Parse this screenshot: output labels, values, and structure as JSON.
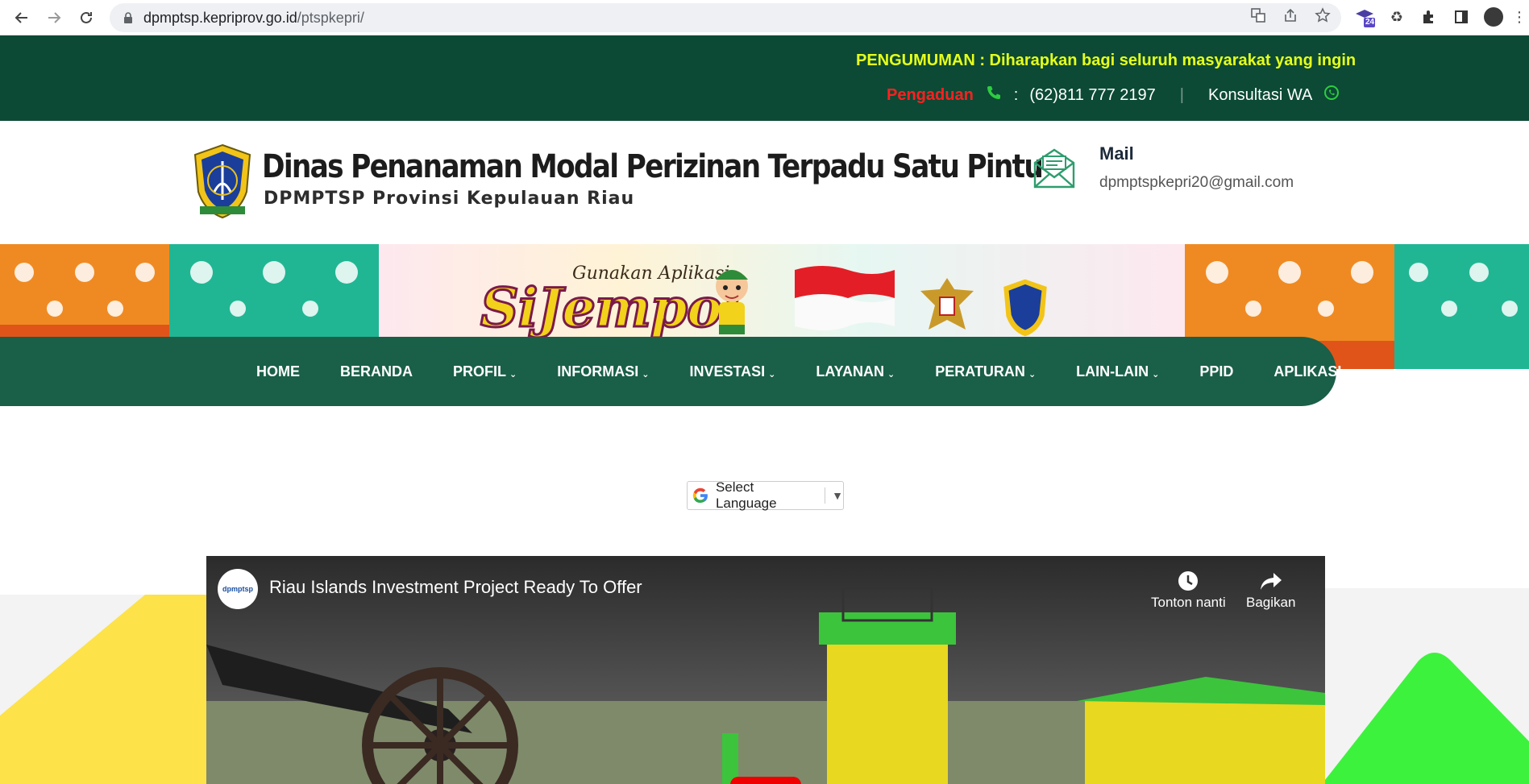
{
  "browser": {
    "url_host": "dpmptsp.kepriprov.go.id",
    "url_path": "/ptspkepri/",
    "extension_badge": "24"
  },
  "topbar": {
    "announcement": "PENGUMUMAN : Diharapkan bagi seluruh masyarakat yang ingin r",
    "pengaduan_label": "Pengaduan",
    "colon": ":",
    "phone": "(62)811 777 2197",
    "separator": "|",
    "wa_label": "Konsultasi WA"
  },
  "header": {
    "title": "Dinas Penanaman Modal Perizinan Terpadu Satu Pintu",
    "subtitle": "DPMPTSP Provinsi Kepulauan Riau",
    "mail_title": "Mail",
    "mail_value": "dpmptspkepri20@gmail.com"
  },
  "banner": {
    "app_prefix": "Gunakan Aplikasi",
    "app_name": "SiJempol"
  },
  "nav": {
    "items": [
      {
        "label": "HOME",
        "dropdown": false
      },
      {
        "label": "BERANDA",
        "dropdown": false
      },
      {
        "label": "PROFIL",
        "dropdown": true
      },
      {
        "label": "INFORMASI",
        "dropdown": true
      },
      {
        "label": "INVESTASI",
        "dropdown": true
      },
      {
        "label": "LAYANAN",
        "dropdown": true
      },
      {
        "label": "PERATURAN",
        "dropdown": true
      },
      {
        "label": "LAIN-LAIN",
        "dropdown": true
      },
      {
        "label": "PPID",
        "dropdown": false
      },
      {
        "label": "APLIKASI",
        "dropdown": false
      }
    ]
  },
  "language": {
    "label": "Select Language"
  },
  "video": {
    "title": "Riau Islands Investment Project Ready To Offer",
    "channel": "dpmptsp",
    "watch_later": "Tonton nanti",
    "share": "Bagikan"
  },
  "colors": {
    "topbar": "#0c4a35",
    "nav": "#1a5f48",
    "announcement": "#e6ff1a",
    "pengaduan": "#ff2020"
  }
}
